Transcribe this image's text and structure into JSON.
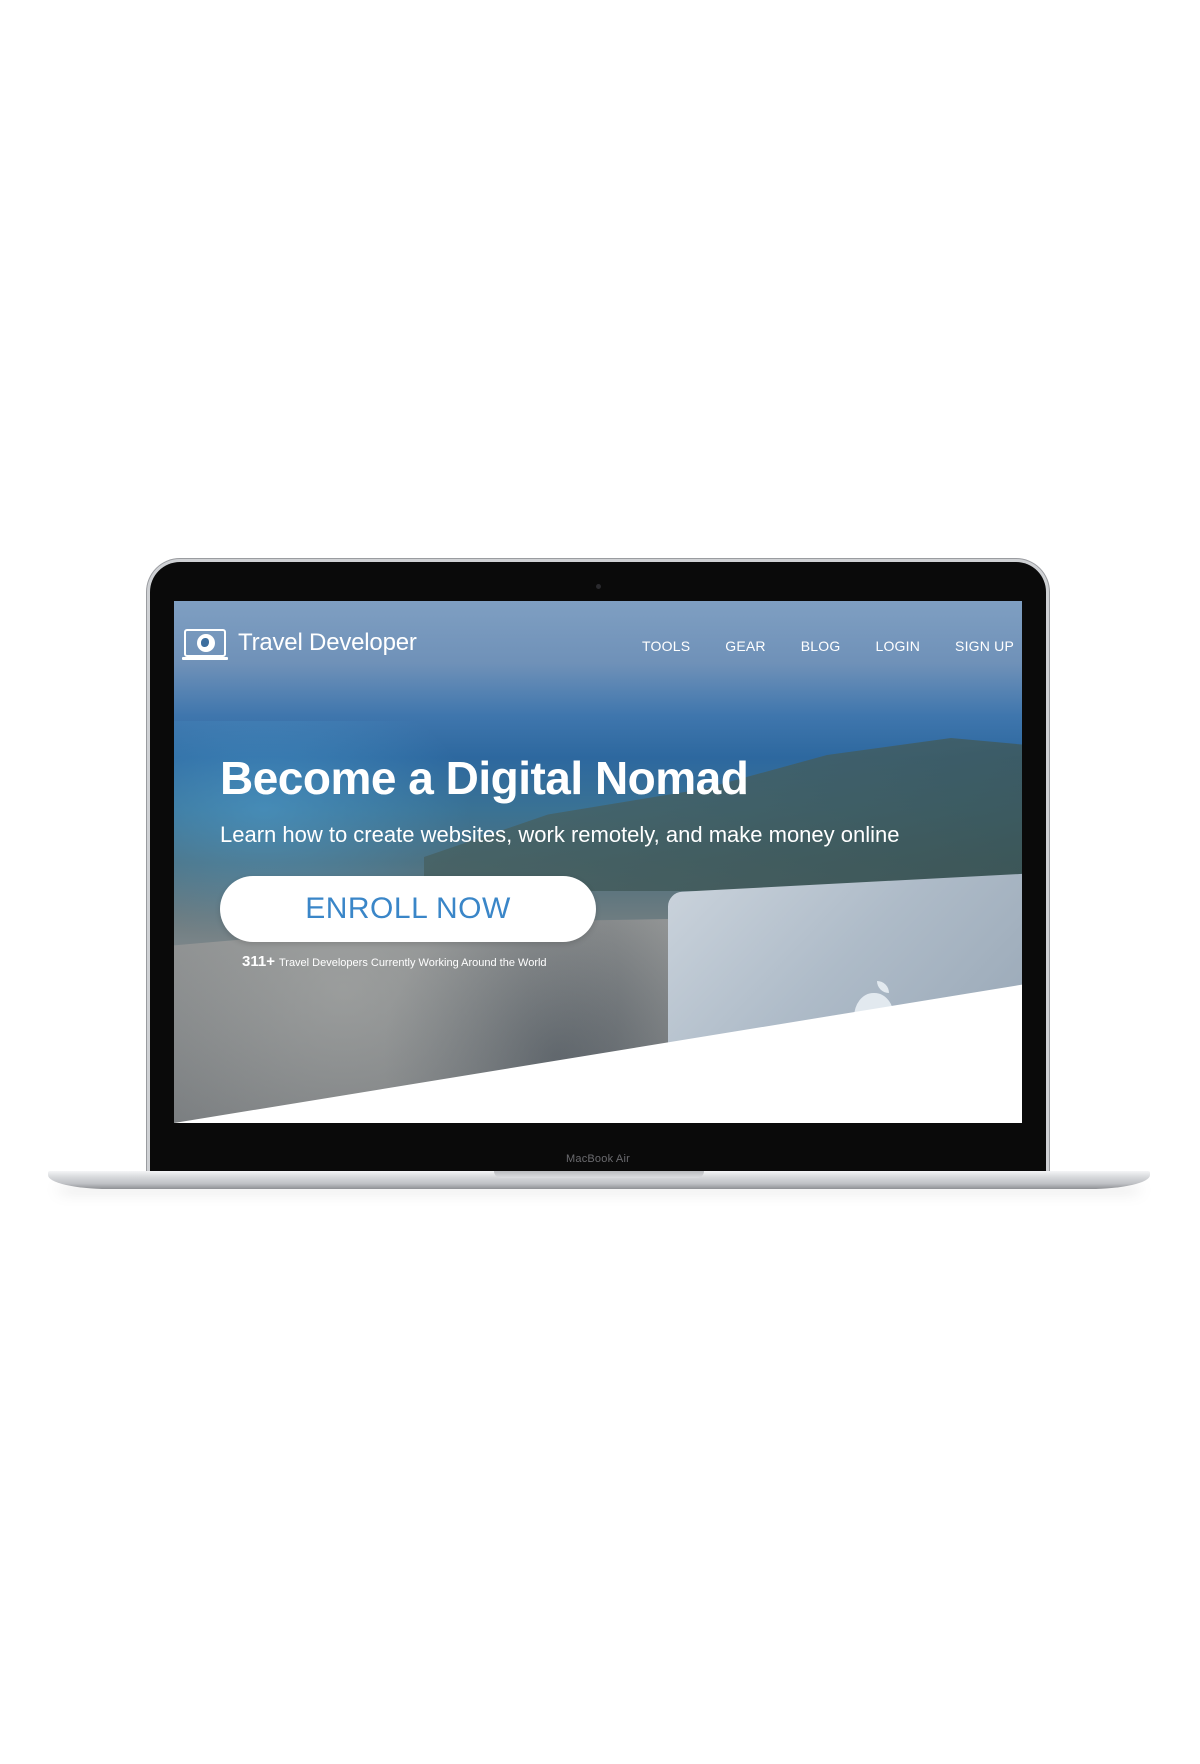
{
  "device": {
    "model_label": "MacBook Air"
  },
  "site": {
    "brand": "Travel Developer",
    "nav": [
      {
        "label": "TOOLS"
      },
      {
        "label": "GEAR"
      },
      {
        "label": "BLOG"
      },
      {
        "label": "LOGIN"
      },
      {
        "label": "SIGN UP"
      }
    ],
    "hero": {
      "headline": "Become a Digital Nomad",
      "subheadline": "Learn how to create websites, work remotely, and make money online",
      "cta_label": "ENROLL NOW",
      "stat_count": "311+",
      "stat_text": "Travel Developers Currently Working Around the World"
    },
    "colors": {
      "cta_text": "#3a86c8",
      "nav_text": "#ffffff"
    },
    "icons": {
      "logo": "globe-laptop-icon"
    }
  }
}
